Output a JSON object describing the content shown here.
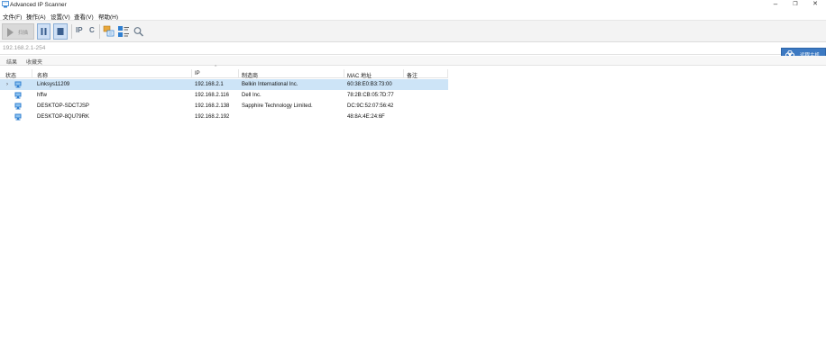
{
  "window": {
    "title": "Advanced IP Scanner",
    "minimize": "–",
    "restore": "❐",
    "close": "✕"
  },
  "menu": [
    "文件(F)",
    "操作(A)",
    "设置(V)",
    "查看(V)",
    "帮助(H)"
  ],
  "toolbar": {
    "scan_label": "扫描",
    "ip_icon": "IP",
    "c_icon": "C"
  },
  "scan_range": "192.168.2.1-254",
  "radmin_button": "远程主机",
  "tabs": [
    "结果",
    "收藏夹"
  ],
  "columns": [
    "状态",
    "名称",
    "IP",
    "制造商",
    "MAC 地址",
    "备注"
  ],
  "rows": [
    {
      "name": "Linksys11209",
      "ip": "192.168.2.1",
      "manufacturer": "Belkin International Inc.",
      "mac": "60:38:E0:B3:73:00",
      "note": "",
      "selected": true,
      "expand": "›"
    },
    {
      "name": "hffw",
      "ip": "192.168.2.116",
      "manufacturer": "Dell Inc.",
      "mac": "78:2B:CB:05:7D:77",
      "note": "",
      "selected": false,
      "expand": ""
    },
    {
      "name": "DESKTOP-SDCTJSP",
      "ip": "192.168.2.138",
      "manufacturer": "Sapphire Technology Limited.",
      "mac": "DC:9C:52:07:56:42",
      "note": "",
      "selected": false,
      "expand": ""
    },
    {
      "name": "DESKTOP-8QU79RK",
      "ip": "192.168.2.192",
      "manufacturer": "",
      "mac": "48:8A:4E:24:6F",
      "note": "",
      "selected": false,
      "expand": ""
    }
  ],
  "colors": {
    "selection": "#cde4f7",
    "accent": "#3c79c2",
    "pc_icon": "#2f7fd0"
  },
  "icons": [
    "app-scanner-icon",
    "play-icon",
    "pause-icon",
    "stop-icon",
    "ip-icon",
    "c-icon",
    "scan-subnet-icon",
    "list-view-icon",
    "search-icon",
    "radmin-icon",
    "computer-icon"
  ]
}
